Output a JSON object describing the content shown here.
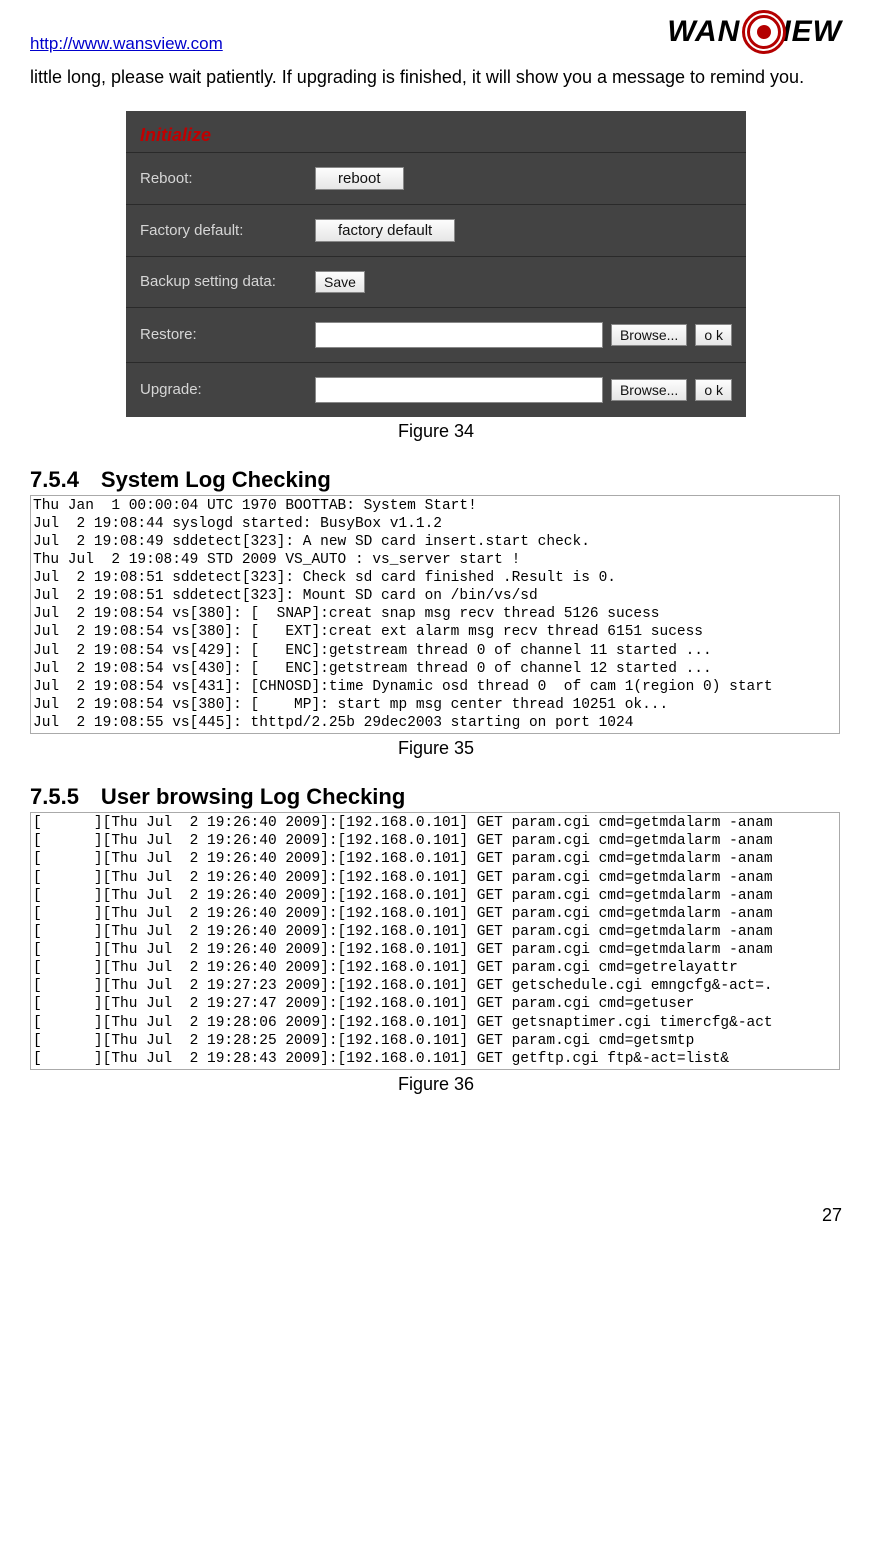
{
  "header": {
    "url": "http://www.wansview.com",
    "logo_left": "WAN",
    "logo_right": "IEW"
  },
  "intro_paragraph": "little long, please wait patiently. If upgrading is finished, it will show you a message to remind you.",
  "panel": {
    "initialize": "Initialize",
    "reboot_label": "Reboot:",
    "reboot_btn": "reboot",
    "factory_label": "Factory default:",
    "factory_btn": "factory default",
    "backup_label": "Backup setting data:",
    "save_btn": "Save",
    "restore_label": "Restore:",
    "upgrade_label": "Upgrade:",
    "browse_btn": "Browse...",
    "ok_btn": "o k"
  },
  "caption34": "Figure 34",
  "section754": "7.5.4 System Log Checking",
  "syslog": "Thu Jan  1 00:00:04 UTC 1970 BOOTTAB: System Start!\nJul  2 19:08:44 syslogd started: BusyBox v1.1.2\nJul  2 19:08:49 sddetect[323]: A new SD card insert.start check.\nThu Jul  2 19:08:49 STD 2009 VS_AUTO : vs_server start !\nJul  2 19:08:51 sddetect[323]: Check sd card finished .Result is 0.\nJul  2 19:08:51 sddetect[323]: Mount SD card on /bin/vs/sd\nJul  2 19:08:54 vs[380]: [  SNAP]:creat snap msg recv thread 5126 sucess\nJul  2 19:08:54 vs[380]: [   EXT]:creat ext alarm msg recv thread 6151 sucess\nJul  2 19:08:54 vs[429]: [   ENC]:getstream thread 0 of channel 11 started ...\nJul  2 19:08:54 vs[430]: [   ENC]:getstream thread 0 of channel 12 started ...\nJul  2 19:08:54 vs[431]: [CHNOSD]:time Dynamic osd thread 0  of cam 1(region 0) start\nJul  2 19:08:54 vs[380]: [    MP]: start mp msg center thread 10251 ok...\nJul  2 19:08:55 vs[445]: thttpd/2.25b 29dec2003 starting on port 1024",
  "caption35": "Figure 35",
  "section755": "7.5.5 User browsing Log Checking",
  "userlog": "[      ][Thu Jul  2 19:26:40 2009]:[192.168.0.101] GET param.cgi cmd=getmdalarm -anam\n[      ][Thu Jul  2 19:26:40 2009]:[192.168.0.101] GET param.cgi cmd=getmdalarm -anam\n[      ][Thu Jul  2 19:26:40 2009]:[192.168.0.101] GET param.cgi cmd=getmdalarm -anam\n[      ][Thu Jul  2 19:26:40 2009]:[192.168.0.101] GET param.cgi cmd=getmdalarm -anam\n[      ][Thu Jul  2 19:26:40 2009]:[192.168.0.101] GET param.cgi cmd=getmdalarm -anam\n[      ][Thu Jul  2 19:26:40 2009]:[192.168.0.101] GET param.cgi cmd=getmdalarm -anam\n[      ][Thu Jul  2 19:26:40 2009]:[192.168.0.101] GET param.cgi cmd=getmdalarm -anam\n[      ][Thu Jul  2 19:26:40 2009]:[192.168.0.101] GET param.cgi cmd=getmdalarm -anam\n[      ][Thu Jul  2 19:26:40 2009]:[192.168.0.101] GET param.cgi cmd=getrelayattr\n[      ][Thu Jul  2 19:27:23 2009]:[192.168.0.101] GET getschedule.cgi emngcfg&-act=.\n[      ][Thu Jul  2 19:27:47 2009]:[192.168.0.101] GET param.cgi cmd=getuser\n[      ][Thu Jul  2 19:28:06 2009]:[192.168.0.101] GET getsnaptimer.cgi timercfg&-act\n[      ][Thu Jul  2 19:28:25 2009]:[192.168.0.101] GET param.cgi cmd=getsmtp\n[      ][Thu Jul  2 19:28:43 2009]:[192.168.0.101] GET getftp.cgi ftp&-act=list&",
  "caption36": "Figure 36",
  "page_number": "27"
}
